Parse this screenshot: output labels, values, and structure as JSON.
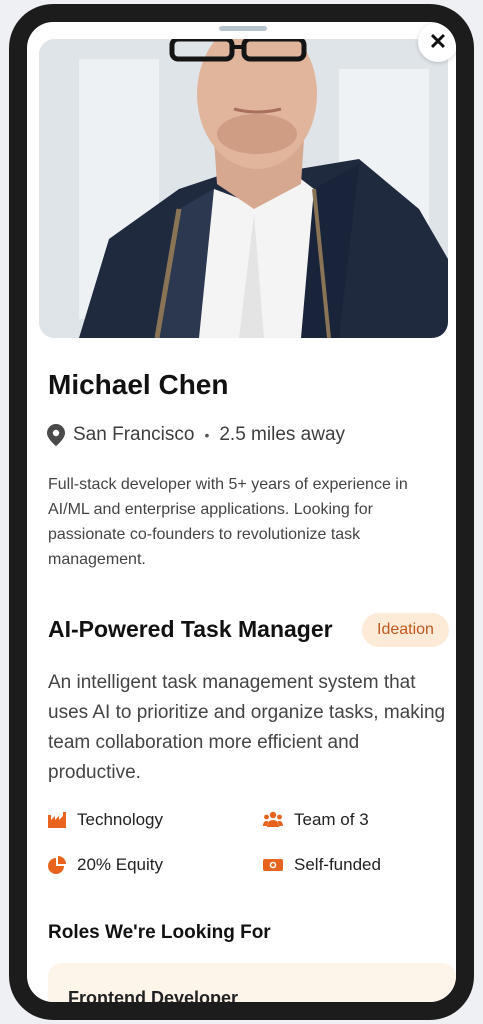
{
  "profile": {
    "name": "Michael Chen",
    "location": "San Francisco",
    "separator": "•",
    "distance": "2.5 miles away",
    "bio": "Full-stack developer with 5+ years of experience in AI/ML and enterprise applications. Looking for passionate co-founders to revolutionize task management."
  },
  "controls": {
    "close_label": "✕"
  },
  "project": {
    "title": "AI-Powered Task Manager",
    "stage": "Ideation",
    "description": "An intelligent task management system that uses AI to prioritize and organize tasks, making team collaboration more efficient and productive.",
    "meta": {
      "industry": "Technology",
      "team": "Team of 3",
      "equity": "20% Equity",
      "funding": "Self-funded"
    }
  },
  "roles": {
    "heading": "Roles We're Looking For",
    "items": [
      {
        "title": "Frontend Developer"
      }
    ]
  },
  "colors": {
    "accent": "#e8641e",
    "badge_bg": "#fdebd8",
    "badge_text": "#c3571b",
    "role_card_bg": "#fef5ea"
  },
  "icons": {
    "location": "map-pin-icon",
    "industry": "factory-icon",
    "team": "users-icon",
    "equity": "pie-chart-icon",
    "funding": "money-bill-icon",
    "close": "close-icon"
  }
}
